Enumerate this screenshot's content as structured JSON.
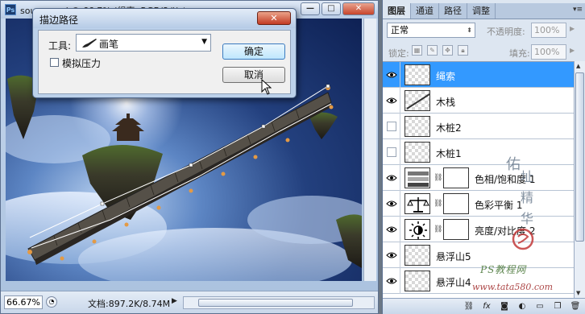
{
  "document": {
    "title": "source.psd @ 66.7% (绳索, RGB/8#) *",
    "logo": "Ps",
    "window_buttons": [
      "—",
      "□",
      "✕"
    ],
    "zoom": "66.67%",
    "doc_info": "文档:897.2K/8.74M"
  },
  "dialog": {
    "title": "描边路径",
    "close": "✕",
    "tool_label": "工具:",
    "tool_value": "画笔",
    "simulate_pressure": "模拟压力",
    "simulate_pressure_checked": false,
    "ok": "确定",
    "cancel": "取消"
  },
  "panel": {
    "tabs": [
      "图层",
      "通道",
      "路径",
      "调整"
    ],
    "active_tab": "图层",
    "blend_mode": "正常",
    "opacity_label": "不透明度:",
    "opacity_value": "100%",
    "lock_label": "锁定:",
    "fill_label": "填充:",
    "fill_value": "100%",
    "layers": [
      {
        "name": "绳索",
        "visible": true,
        "selected": true,
        "kind": "pixel"
      },
      {
        "name": "木栈",
        "visible": true,
        "selected": false,
        "kind": "pixel"
      },
      {
        "name": "木桩2",
        "visible": false,
        "selected": false,
        "kind": "pixel"
      },
      {
        "name": "木桩1",
        "visible": false,
        "selected": false,
        "kind": "pixel"
      },
      {
        "name": "色相/饱和度 1",
        "visible": true,
        "selected": false,
        "kind": "hue-saturation"
      },
      {
        "name": "色彩平衡 1",
        "visible": true,
        "selected": false,
        "kind": "color-balance"
      },
      {
        "name": "亮度/对比度 2",
        "visible": true,
        "selected": false,
        "kind": "brightness-contrast"
      },
      {
        "name": "悬浮山5",
        "visible": true,
        "selected": false,
        "kind": "pixel"
      },
      {
        "name": "悬浮山4",
        "visible": true,
        "selected": false,
        "kind": "pixel"
      }
    ],
    "bottom_icons": [
      "link-icon",
      "fx-icon",
      "mask-icon",
      "adjustment-icon",
      "group-icon",
      "new-layer-icon",
      "trash-icon"
    ]
  },
  "watermark": {
    "brand": "PS教程网",
    "url": "www.tata580.com",
    "vertical_chars": [
      "佑",
      "址",
      "精",
      "华"
    ]
  },
  "colors": {
    "selected_layer": "#3399ff",
    "close_button": "#c7442b"
  }
}
